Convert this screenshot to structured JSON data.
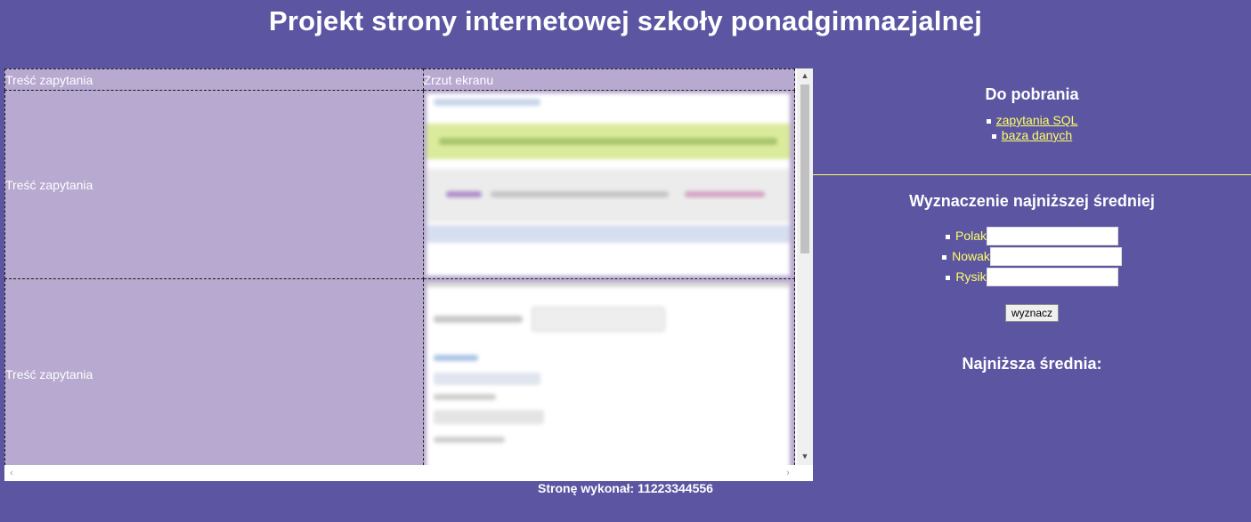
{
  "header": {
    "title": "Projekt strony internetowej szkoły ponadgimnazjalnej"
  },
  "table": {
    "headers": [
      "Treść zapytania",
      "Zrzut ekranu"
    ],
    "rows": [
      {
        "query": "Treść zapytania"
      },
      {
        "query": "Treść zapytania"
      }
    ]
  },
  "downloads": {
    "title": "Do pobrania",
    "links": [
      "zapytania SQL",
      "baza danych"
    ]
  },
  "calc": {
    "title": "Wyznaczenie najniższej średniej",
    "fields": [
      {
        "label": "Polak",
        "value": ""
      },
      {
        "label": "Nowak",
        "value": ""
      },
      {
        "label": "Rysik",
        "value": ""
      }
    ],
    "button": "wyznacz",
    "result_label": "Najniższa średnia:"
  },
  "footer": {
    "text": "Stronę wykonał: 11223344556"
  },
  "colors": {
    "page_bg": "#5b55a2",
    "table_bg": "#b7a9cf",
    "link": "#ffff66",
    "separator": "#ffff66"
  }
}
